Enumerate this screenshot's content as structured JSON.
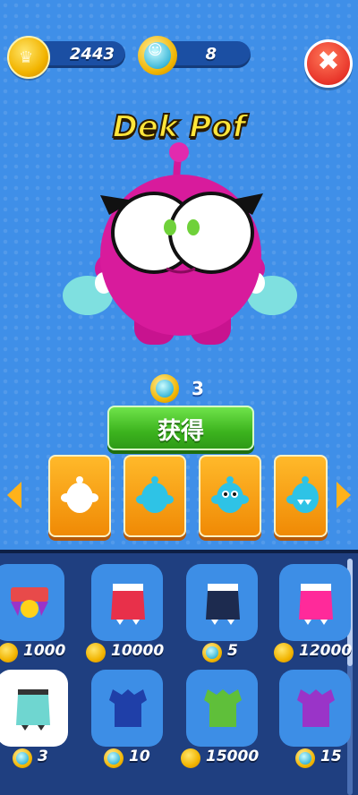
{
  "hud": {
    "coins": "2443",
    "gems": "8"
  },
  "character": {
    "name": "Dek Pof",
    "price": "3"
  },
  "buy_button": {
    "label": "获得"
  },
  "carousel": {
    "cards": [
      {
        "name": "white"
      },
      {
        "name": "cyan"
      },
      {
        "name": "cyan-eyes"
      },
      {
        "name": "cyan-teeth"
      }
    ]
  },
  "shop": {
    "items": [
      {
        "price": "1000",
        "currency": "coin",
        "color": "#e84a4a"
      },
      {
        "price": "10000",
        "currency": "coin",
        "color": "#e8304a"
      },
      {
        "price": "5",
        "currency": "gem",
        "color": "#1d2b4f"
      },
      {
        "price": "12000",
        "currency": "coin",
        "color": "#ff2a9a"
      },
      {
        "price": "3",
        "currency": "gem",
        "color": "#6fd6d0"
      },
      {
        "price": "10",
        "currency": "gem",
        "color": "#1f3fa8"
      },
      {
        "price": "15000",
        "currency": "coin",
        "color": "#5fbf3a"
      },
      {
        "price": "15",
        "currency": "gem",
        "color": "#9a34c8"
      }
    ]
  },
  "colors": {
    "background": "#3f8fe8",
    "accent_yellow": "#ffe63a",
    "buy_green": "#3cb31e",
    "card_orange": "#f5a21a",
    "close_red": "#e8352a",
    "character_magenta": "#d4189a"
  }
}
